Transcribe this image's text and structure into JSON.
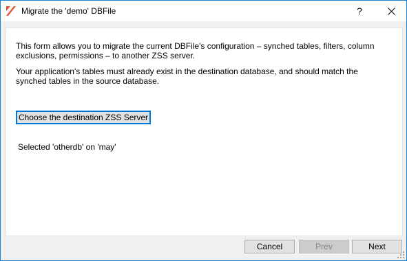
{
  "window": {
    "title": "Migrate the 'demo' DBFile",
    "help_label": "?"
  },
  "content": {
    "intro": "This form allows you to migrate the current DBFile's configuration – synched tables, filters, column exclusions, permissions – to another ZSS server.",
    "note": "Your application's tables must already exist in the destination database, and should match the synched tables in the source database.",
    "choose_button_label": "Choose the destination ZSS Server",
    "selected_text": "Selected 'otherdb' on 'may'"
  },
  "footer": {
    "cancel_label": "Cancel",
    "prev_label": "Prev",
    "next_label": "Next"
  },
  "colors": {
    "window_border": "#1883d7",
    "app_icon_accent": "#e8512a",
    "focus_border": "#0078d7"
  }
}
